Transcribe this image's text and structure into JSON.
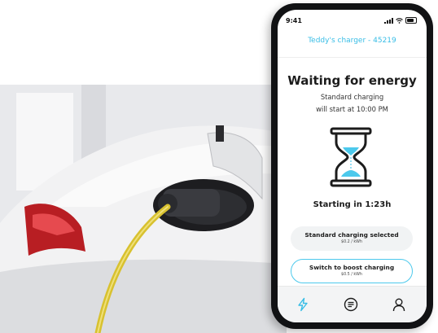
{
  "colors": {
    "accent": "#38bde6",
    "option_border": "#4cc9ec",
    "cable": "#d8c12f",
    "phone_frame": "#111214"
  },
  "status_bar": {
    "time": "9:41"
  },
  "app": {
    "charger_title": "Teddy's charger - 45219",
    "status_title": "Waiting for energy",
    "status_line_1": "Standard charging",
    "status_line_2": "will start at 10:00 PM",
    "countdown": "Starting in 1:23h"
  },
  "options": [
    {
      "label": "Standard charging selected",
      "price": "$0.2 / kWh"
    },
    {
      "label": "Switch to boost charging",
      "price": "$0.5 / kWh"
    }
  ],
  "tabs": [
    {
      "icon": "lightning-icon"
    },
    {
      "icon": "list-icon"
    },
    {
      "icon": "user-icon"
    }
  ]
}
